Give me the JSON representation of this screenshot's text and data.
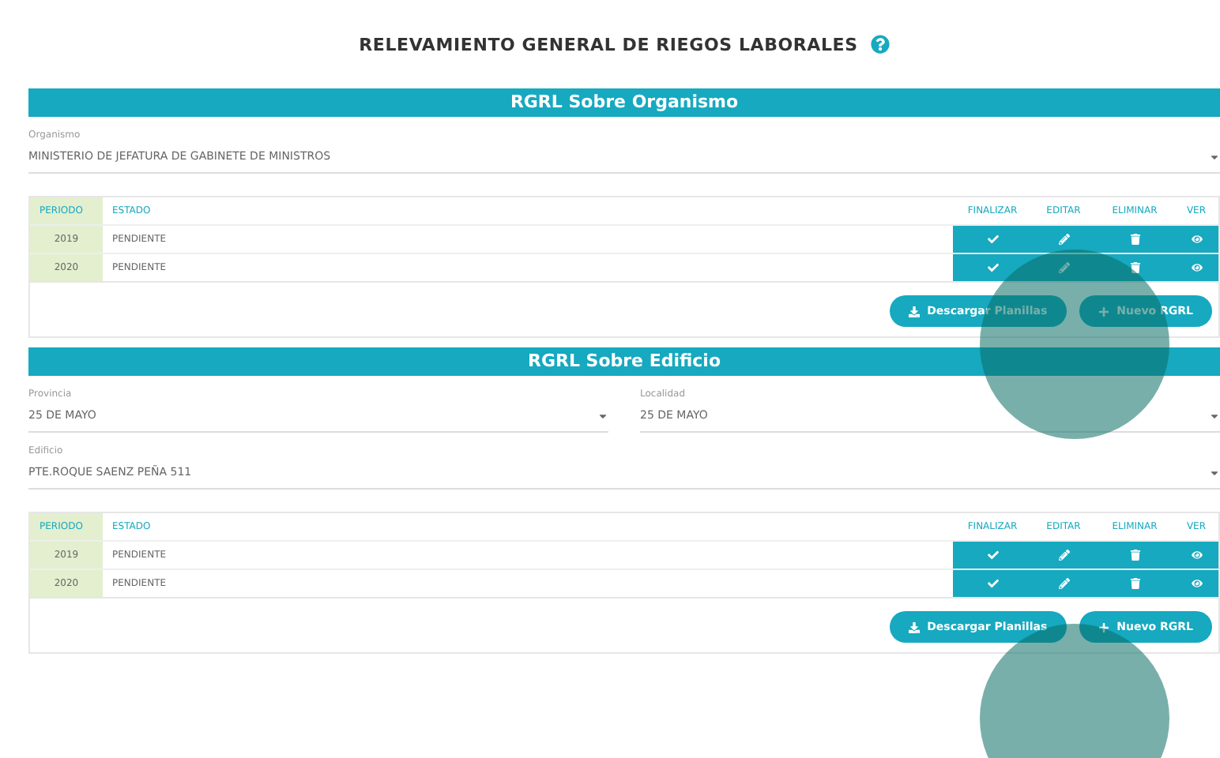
{
  "title": "RELEVAMIENTO GENERAL DE RIEGOS LABORALES",
  "sections": [
    {
      "header": "RGRL Sobre Organismo",
      "fields": [
        [
          {
            "label": "Organismo",
            "value": "MINISTERIO DE JEFATURA DE GABINETE DE MINISTROS"
          }
        ]
      ],
      "table": {
        "columns": [
          "PERIODO",
          "ESTADO",
          "FINALIZAR",
          "EDITAR",
          "ELIMINAR",
          "VER"
        ],
        "rows": [
          {
            "period": "2019",
            "status": "PENDIENTE"
          },
          {
            "period": "2020",
            "status": "PENDIENTE"
          }
        ]
      },
      "buttons": [
        {
          "kind": "download",
          "label": "Descargar Planillas"
        },
        {
          "kind": "new",
          "label": "Nuevo RGRL"
        }
      ]
    },
    {
      "header": "RGRL Sobre Edificio",
      "fields": [
        [
          {
            "label": "Provincia",
            "value": "25 DE MAYO"
          },
          {
            "label": "Localidad",
            "value": "25 DE MAYO"
          }
        ],
        [
          {
            "label": "Edificio",
            "value": "PTE.ROQUE SAENZ PEÑA 511"
          }
        ]
      ],
      "table": {
        "columns": [
          "PERIODO",
          "ESTADO",
          "FINALIZAR",
          "EDITAR",
          "ELIMINAR",
          "VER"
        ],
        "rows": [
          {
            "period": "2019",
            "status": "PENDIENTE"
          },
          {
            "period": "2020",
            "status": "PENDIENTE"
          }
        ]
      },
      "buttons": [
        {
          "kind": "download",
          "label": "Descargar Planillas"
        },
        {
          "kind": "new",
          "label": "Nuevo RGRL"
        }
      ]
    }
  ]
}
